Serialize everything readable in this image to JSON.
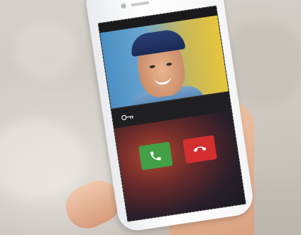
{
  "phone": {
    "status_left": "",
    "status_right": "",
    "caller_name": "",
    "video_icons": "",
    "door_label": "",
    "call_status": ""
  },
  "colors": {
    "answer": "#43a047",
    "decline": "#d32f2f"
  },
  "icons": {
    "answer": "phone-icon",
    "decline": "hang-up-icon",
    "door": "key-icon"
  }
}
